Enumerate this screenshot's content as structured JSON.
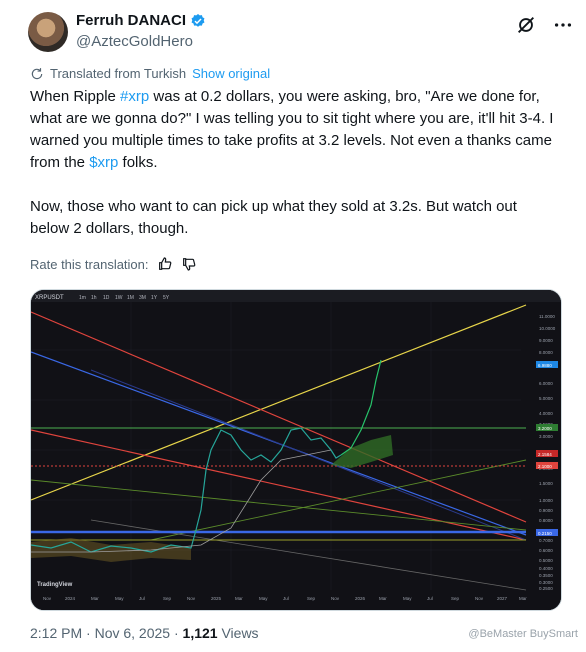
{
  "author": {
    "display_name": "Ferruh DANACI",
    "handle": "@AztecGoldHero"
  },
  "translation": {
    "label": "Translated from Turkish",
    "show_original": "Show original"
  },
  "tweet": {
    "p1_a": "When Ripple ",
    "p1_tag": "#xrp",
    "p1_b": " was at 0.2 dollars, you were asking, bro, \"Are we done for, what are we gonna do?\" I was telling you to sit tight where you are, it'll hit 3-4. I warned you multiple times to take profits at 3.2 levels. Not even a thanks came from the ",
    "p1_tag2": "$xrp",
    "p1_c": " folks.",
    "p2": "Now, those who want to can pick up what they sold at 3.2s. But watch out below 2 dollars, though."
  },
  "rate": {
    "label": "Rate this translation:"
  },
  "chart": {
    "toolbar_symbol": "XRPUSDT",
    "intervals": [
      "1m",
      "1h",
      "1D",
      "1W",
      "1M",
      "3M",
      "1Y",
      "5Y"
    ],
    "price_labels": [
      "11.0000",
      "10.0000",
      "9.0000",
      "8.0000",
      "7.0000",
      "6.0000",
      "5.0000",
      "4.0000",
      "3.5000",
      "3.0000",
      "2.5000",
      "2.0000",
      "1.5000",
      "1.0000",
      "0.9000",
      "0.8000",
      "0.7000",
      "0.6000",
      "0.5000",
      "0.4000",
      "0.3500",
      "0.3000",
      "0.2500"
    ],
    "date_labels": [
      "Nov",
      "2024",
      "Mar",
      "May",
      "Jul",
      "Sep",
      "Nov",
      "2025",
      "Mar",
      "May",
      "Jul",
      "Sep",
      "Nov",
      "2026",
      "Mar",
      "May",
      "Jul",
      "Sep",
      "Nov",
      "2027",
      "Mar"
    ],
    "logo": "TradingView",
    "tag_values": [
      "6.9880",
      "3.2000",
      "2.1584",
      "2.1000",
      "0.2150"
    ]
  },
  "footer": {
    "time": "2:12 PM · Nov 6, 2025 · ",
    "views_count": "1,121",
    "views_label": " Views"
  },
  "watermark": "@BeMaster BuySmart",
  "colors": {
    "link": "#1d9bf0",
    "verified": "#1d9bf0",
    "muted": "#536471"
  }
}
